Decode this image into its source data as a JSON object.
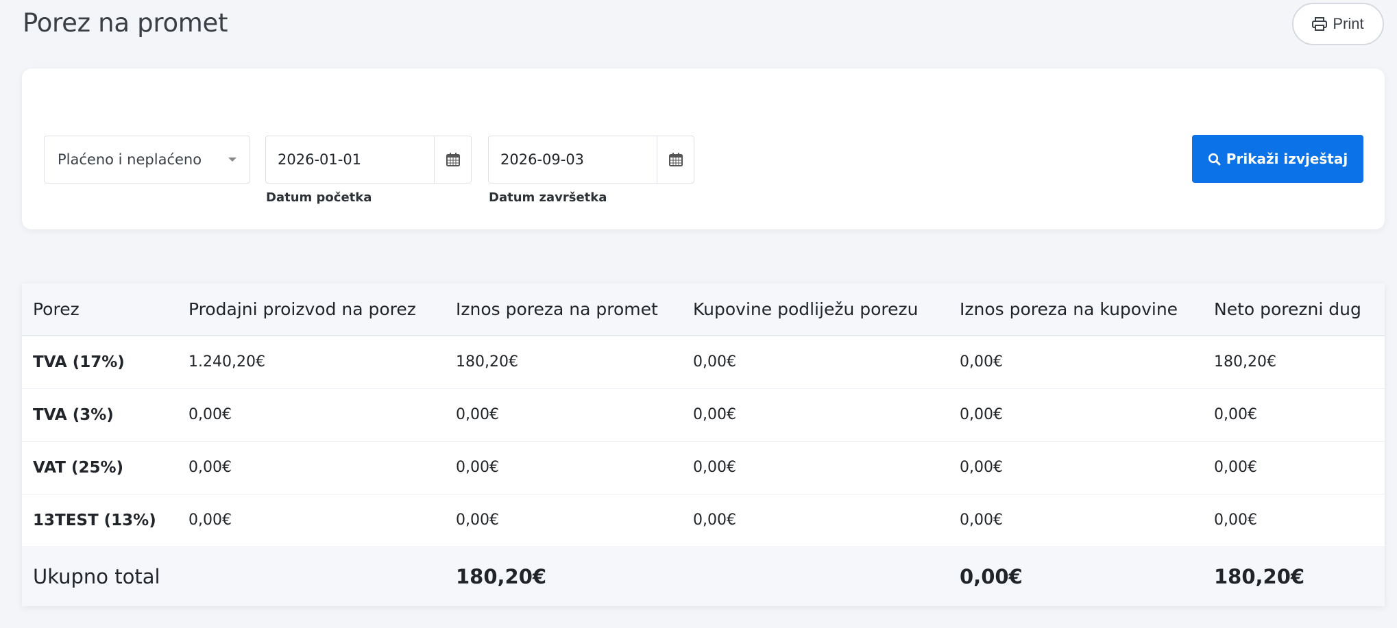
{
  "page": {
    "title": "Porez na promet",
    "print_label": "Print"
  },
  "filters": {
    "payment_status": "Plaćeno i neplaćeno",
    "start_date": {
      "value": "2026-01-01",
      "label": "Datum početka"
    },
    "end_date": {
      "value": "2026-09-03",
      "label": "Datum završetka"
    },
    "submit_label": "Prikaži izvještaj"
  },
  "table": {
    "columns": [
      "Porez",
      "Prodajni proizvod na porez",
      "Iznos poreza na promet",
      "Kupovine podliježu porezu",
      "Iznos poreza na kupovine",
      "Neto porezni dug"
    ],
    "rows": [
      [
        "TVA (17%)",
        "1.240,20€",
        "180,20€",
        "0,00€",
        "0,00€",
        "180,20€"
      ],
      [
        "TVA (3%)",
        "0,00€",
        "0,00€",
        "0,00€",
        "0,00€",
        "0,00€"
      ],
      [
        "VAT (25%)",
        "0,00€",
        "0,00€",
        "0,00€",
        "0,00€",
        "0,00€"
      ],
      [
        "13TEST (13%)",
        "0,00€",
        "0,00€",
        "0,00€",
        "0,00€",
        "0,00€"
      ]
    ],
    "total": {
      "label": "Ukupno total",
      "sales_tax": "180,20€",
      "purchase_tax": "0,00€",
      "net": "180,20€"
    }
  },
  "icons": {
    "print": "printer-icon",
    "calendar": "calendar-icon",
    "search": "search-icon"
  },
  "colors": {
    "primary": "#0b72e7",
    "background": "#f3f5f9"
  }
}
